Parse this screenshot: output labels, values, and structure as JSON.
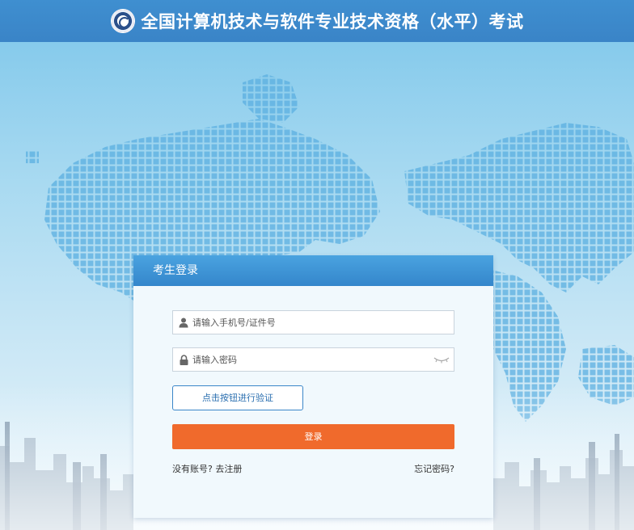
{
  "header": {
    "title": "全国计算机技术与软件专业技术资格（水平）考试"
  },
  "login": {
    "panel_title": "考生登录",
    "username_placeholder": "请输入手机号/证件号",
    "password_placeholder": "请输入密码",
    "verify_label": "点击按钮进行验证",
    "submit_label": "登录",
    "no_account_text": "没有账号?",
    "register_link": "去注册",
    "forgot_link": "忘记密码?"
  },
  "icons": {
    "user": "user-icon",
    "lock": "lock-icon",
    "eye": "eye-closed-icon",
    "logo": "exam-logo-icon"
  },
  "colors": {
    "header": "#3a84c7",
    "panel_head": "#3486cb",
    "login_button": "#f06a2c",
    "verify_border": "#3a86c8"
  }
}
